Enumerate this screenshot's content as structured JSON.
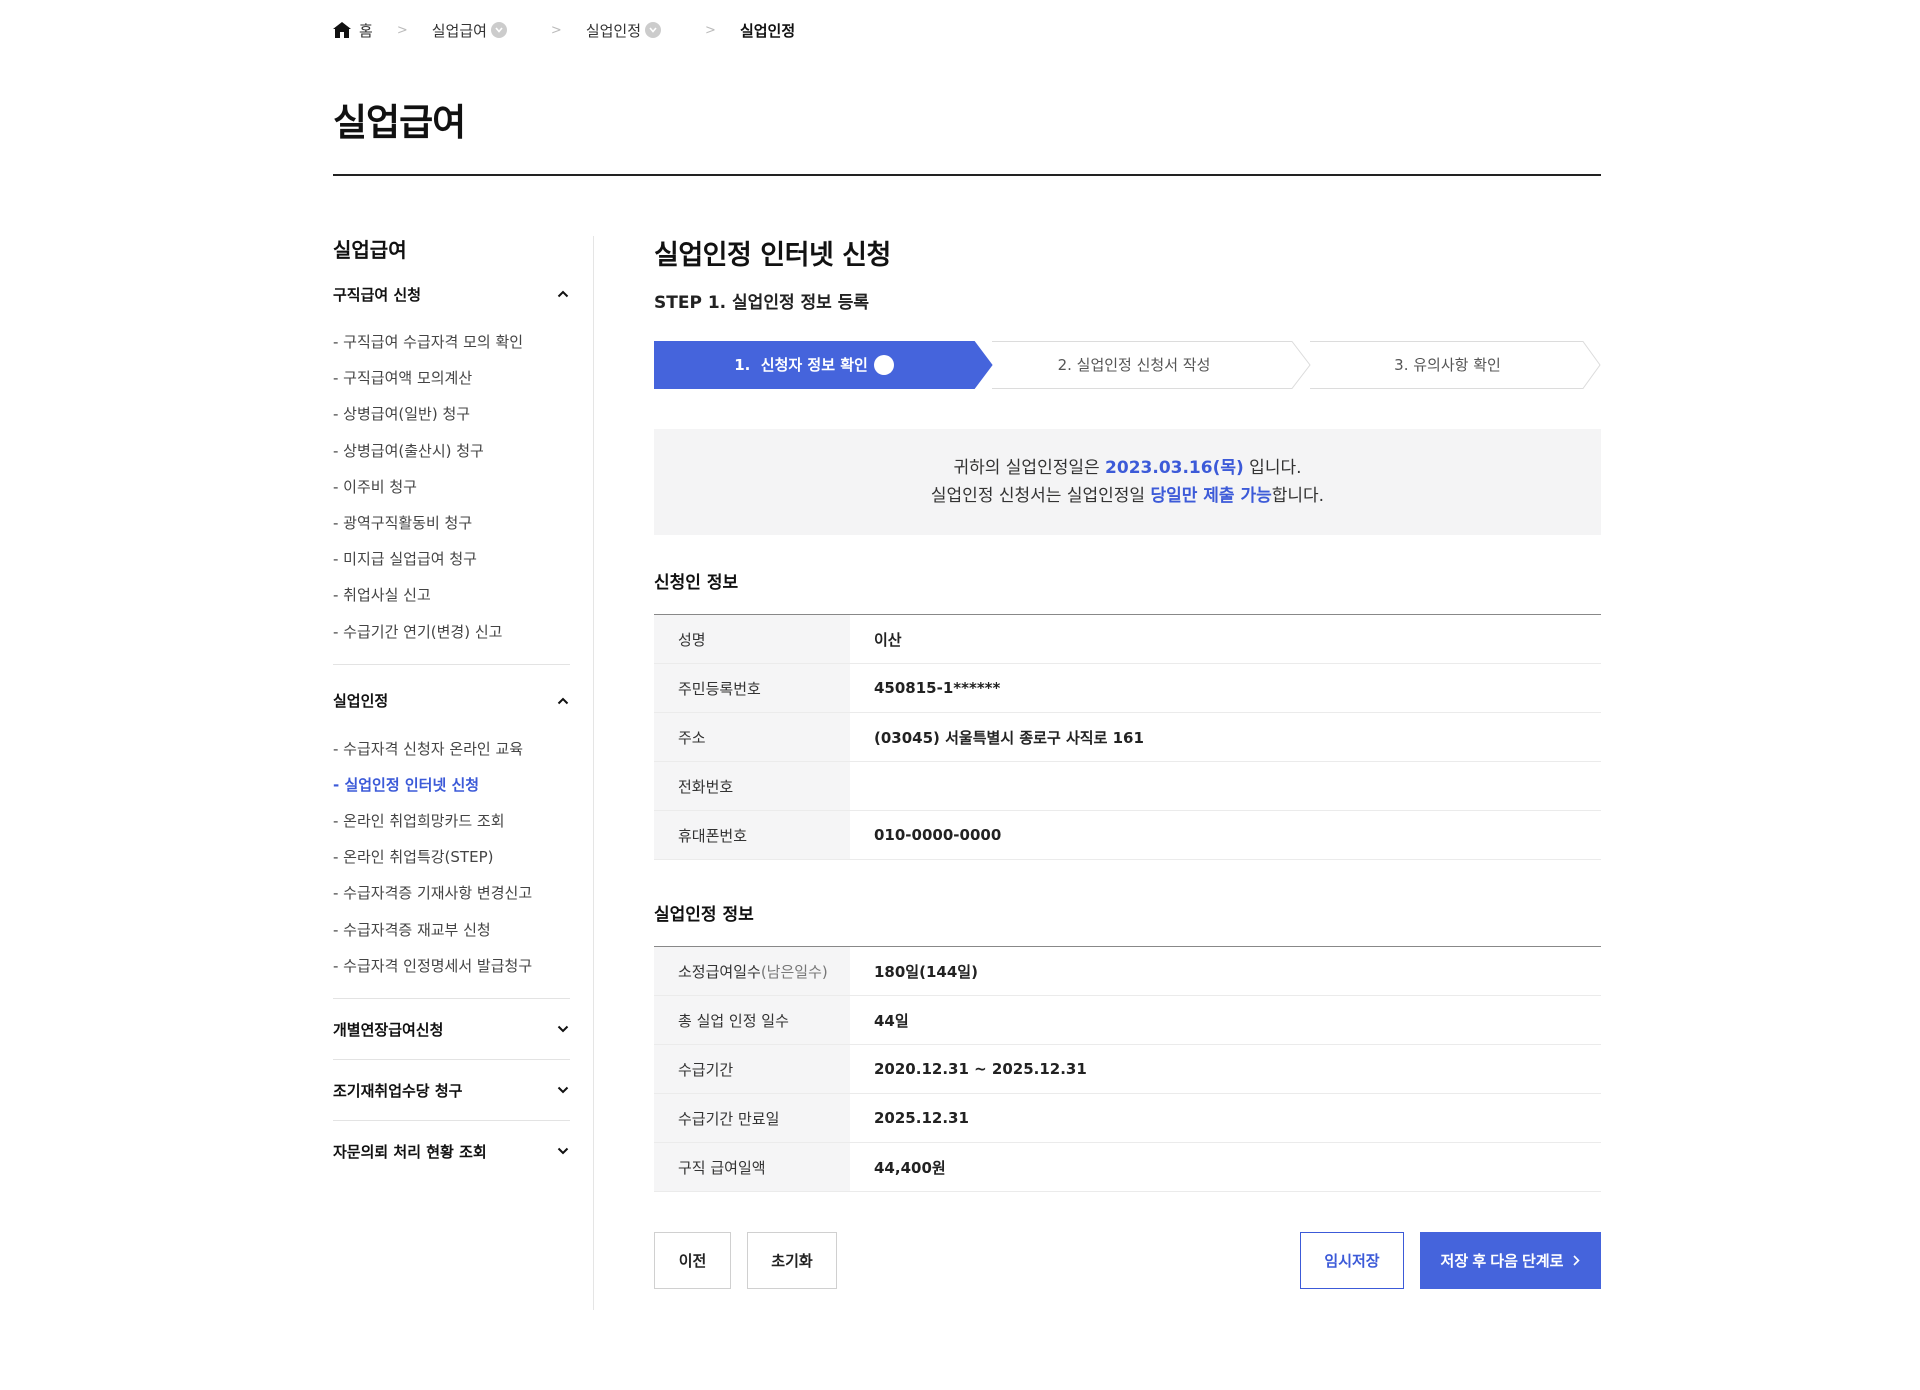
{
  "breadcrumb": {
    "home": "홈",
    "level1": "실업급여",
    "level2": "실업인정",
    "current": "실업인정"
  },
  "page_title": "실업급여",
  "sidebar": {
    "title": "실업급여",
    "groups": [
      {
        "label": "구직급여 신청",
        "expanded": true,
        "items": [
          "- 구직급여 수급자격 모의 확인",
          "- 구직급여액 모의계산",
          "- 상병급여(일반) 청구",
          "- 상병급여(출산시) 청구",
          "- 이주비 청구",
          "- 광역구직활동비 청구",
          "- 미지급 실업급여 청구",
          "- 취업사실 신고",
          "- 수급기간 연기(변경) 신고"
        ]
      },
      {
        "label": "실업인정",
        "expanded": true,
        "items": [
          "- 수급자격 신청자 온라인 교육",
          "- 실업인정 인터넷 신청",
          "- 온라인 취업희망카드 조회",
          "- 온라인 취업특강(STEP)",
          "- 수급자격증 기재사항 변경신고",
          "- 수급자격증 재교부 신청",
          "- 수급자격 인정명세서 발급청구"
        ]
      },
      {
        "label": "개별연장급여신청",
        "expanded": false
      },
      {
        "label": "조기재취업수당 청구",
        "expanded": false
      },
      {
        "label": "자문의뢰 처리 현황 조회",
        "expanded": false
      }
    ]
  },
  "main": {
    "title": "실업인정 인터넷 신청",
    "step_label": "STEP 1. 실업인정 정보 등록",
    "steps": [
      "1.  신청자 정보 확인",
      "2. 실업인정 신청서 작성",
      "3. 유의사항 확인"
    ],
    "notice": {
      "line1_a": "귀하의 실업인정일은 ",
      "line1_date": "2023.03.16(목)",
      "line1_b": " 입니다.",
      "line2_a": "실업인정 신청서는 실업인정일 ",
      "line2_hl": "당일만 제출 가능",
      "line2_b": "합니다."
    },
    "applicant": {
      "title": "신청인 정보",
      "rows": [
        {
          "label": "성명",
          "value": "이산"
        },
        {
          "label": "주민등록번호",
          "value": "450815-1******"
        },
        {
          "label": "주소",
          "value": "(03045) 서울특별시 종로구 사직로 161"
        },
        {
          "label": "전화번호",
          "value": ""
        },
        {
          "label": "휴대폰번호",
          "value": "010-0000-0000"
        }
      ]
    },
    "unemployment": {
      "title": "실업인정 정보",
      "row0_label": "소정급여일수",
      "row0_sub": "(남은일수)",
      "row0_value": "180일(144일)",
      "rows": [
        {
          "label": "총 실업 인정 일수",
          "value": "44일"
        },
        {
          "label": "수급기간",
          "value": "2020.12.31 ~ 2025.12.31"
        },
        {
          "label": "수급기간 만료일",
          "value": "2025.12.31"
        },
        {
          "label": "구직 급여일액",
          "value": "44,400원"
        }
      ]
    },
    "buttons": {
      "prev": "이전",
      "reset": "초기화",
      "temp_save": "임시저장",
      "next": "저장 후 다음 단계로"
    }
  },
  "colors": {
    "accent": "#4564dc",
    "link": "#3c5ad8"
  }
}
